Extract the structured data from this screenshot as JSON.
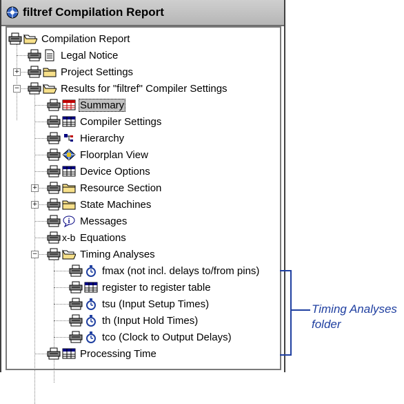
{
  "window": {
    "title": "filtref Compilation Report"
  },
  "tree": {
    "root": "Compilation Report",
    "legal_notice": "Legal Notice",
    "project_settings": "Project Settings",
    "results": "Results for \"filtref\" Compiler Settings",
    "summary": "Summary",
    "compiler_settings": "Compiler Settings",
    "hierarchy": "Hierarchy",
    "floorplan_view": "Floorplan View",
    "device_options": "Device Options",
    "resource_section": "Resource Section",
    "state_machines": "State Machines",
    "messages": "Messages",
    "equations": "Equations",
    "timing_analyses": "Timing Analyses",
    "fmax": "fmax (not incl. delays to/from pins)",
    "register_table": "register to register table",
    "tsu": "tsu (Input Setup Times)",
    "th": "th (Input Hold Times)",
    "tco": "tco (Clock to Output Delays)",
    "processing_time": "Processing Time"
  },
  "annotation": {
    "line1": "Timing Analyses",
    "line2": "folder"
  },
  "colors": {
    "annotation": "#1f3fa0",
    "selection": "#c0c0c0",
    "folder": "#f7e08a"
  }
}
